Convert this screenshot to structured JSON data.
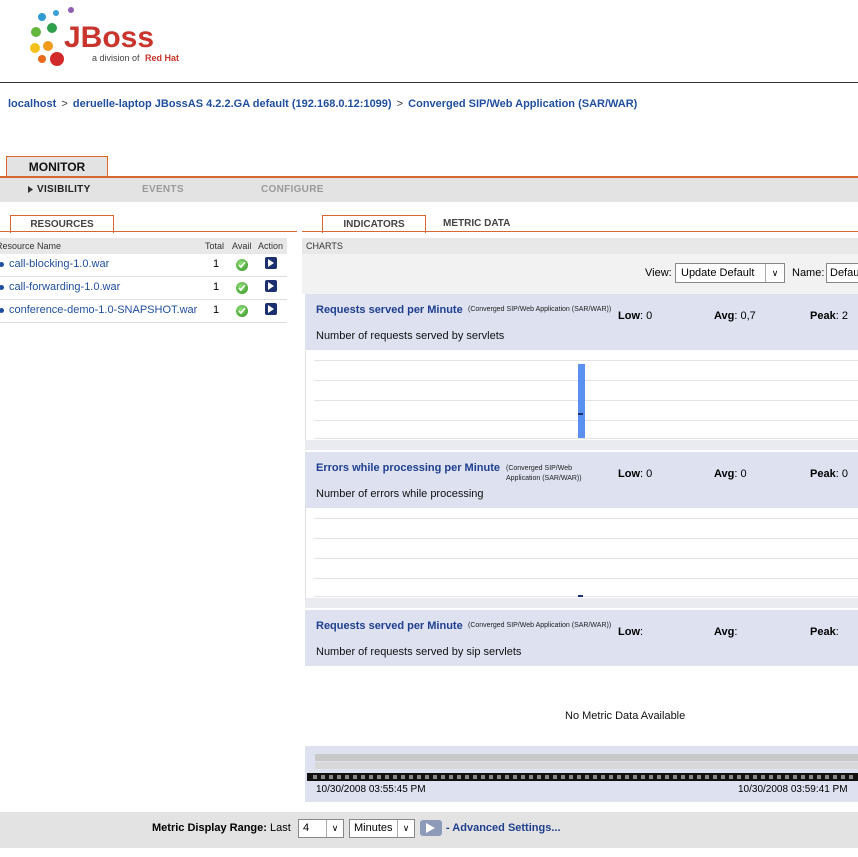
{
  "brand": {
    "logo_text": "JBoss",
    "tagline_prefix": "a division of",
    "tagline_brand": "Red Hat"
  },
  "breadcrumb": {
    "host": "localhost",
    "server": "deruelle-laptop JBossAS 4.2.2.GA default (192.168.0.12:1099)",
    "app": "Converged SIP/Web Application (SAR/WAR)",
    "sep": ">"
  },
  "tabs": {
    "monitor": "MONITOR",
    "sub": {
      "visibility": "VISIBILITY",
      "events": "EVENTS",
      "configure": "CONFIGURE"
    }
  },
  "resources": {
    "tab": "RESOURCES",
    "headers": {
      "name": "Resource Name",
      "total": "Total",
      "avail": "Avail",
      "action": "Action"
    },
    "rows": [
      {
        "name": "call-blocking-1.0.war",
        "total": "1"
      },
      {
        "name": "call-forwarding-1.0.war",
        "total": "1"
      },
      {
        "name": "conference-demo-1.0-SNAPSHOT.war",
        "total": "1"
      }
    ]
  },
  "right_tabs": {
    "indicators": "INDICATORS",
    "metric_data": "METRIC DATA",
    "charts": "CHARTS"
  },
  "view": {
    "label": "View:",
    "value": "Update Default",
    "name_label": "Name:",
    "name_value": "Default"
  },
  "charts": [
    {
      "title": "Requests served per Minute",
      "context": "(Converged SIP/Web Application (SAR/WAR))",
      "desc": "Number of requests served by servlets",
      "low_label": "Low",
      "low": ": 0",
      "avg_label": "Avg",
      "avg": ": 0,7",
      "peak_label": "Peak",
      "peak": ": 2"
    },
    {
      "title": "Errors while processing per Minute",
      "context": "(Converged SIP/Web Application (SAR/WAR))",
      "desc": "Number of errors while processing",
      "low_label": "Low",
      "low": ": 0",
      "avg_label": "Avg",
      "avg": ": 0",
      "peak_label": "Peak",
      "peak": ": 0"
    },
    {
      "title": "Requests served per Minute",
      "context": "(Converged SIP/Web Application (SAR/WAR))",
      "desc": "Number of requests served by sip servlets",
      "low_label": "Low",
      "low": ":",
      "avg_label": "Avg",
      "avg": ":",
      "peak_label": "Peak",
      "peak": ":",
      "no_data": "No Metric Data Available"
    }
  ],
  "timeline": {
    "start": "10/30/2008 03:55:45 PM",
    "end": "10/30/2008 03:59:41 PM"
  },
  "footer": {
    "range_label": "Metric Display Range:",
    "last": "Last",
    "count": "4",
    "unit": "Minutes",
    "advanced": "- Advanced Settings..."
  },
  "colors": {
    "accent_orange": "#d7672f",
    "link_blue": "#1f4f9e",
    "bar_blue": "#5b8ff0",
    "panel_blue": "#dde1f0"
  }
}
